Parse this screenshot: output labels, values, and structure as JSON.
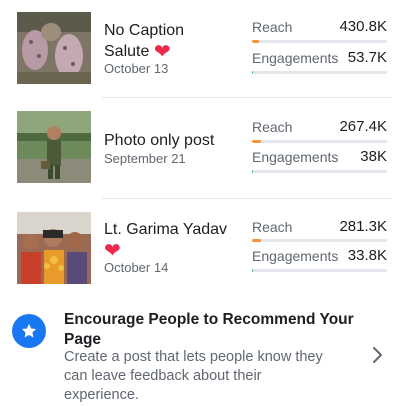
{
  "posts": [
    {
      "title": "No Caption Salute",
      "date": "October 13",
      "reach_label": "Reach",
      "reach_value": "430.8K",
      "reach_fraction": 0.05,
      "engagements_label": "Engagements",
      "engagements_value": "53.7K",
      "engagements_fraction": 0.01
    },
    {
      "title": "Photo only post",
      "date": "September 21",
      "reach_label": "Reach",
      "reach_value": "267.4K",
      "reach_fraction": 0.07,
      "engagements_label": "Engagements",
      "engagements_value": "38K",
      "engagements_fraction": 0.01
    },
    {
      "title": "Lt. Garima Yadav",
      "date": "October 14",
      "reach_label": "Reach",
      "reach_value": "281.3K",
      "reach_fraction": 0.07,
      "engagements_label": "Engagements",
      "engagements_value": "33.8K",
      "engagements_fraction": 0.01
    }
  ],
  "encourage": {
    "title": "Encourage People to Recommend Your Page",
    "description": "Create a post that lets people know they can leave feedback about their experience."
  },
  "colors": {
    "reach_bar": "#f7923a",
    "engagements_bar": "#3aa8a0",
    "heart": "#f02849",
    "accent_blue": "#1877f2"
  },
  "icons": {
    "heart": "heart-icon",
    "star": "star-icon",
    "chevron": "chevron-right-icon"
  }
}
